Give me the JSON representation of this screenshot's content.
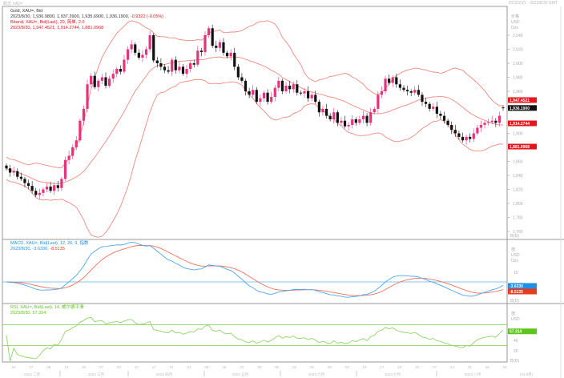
{
  "window": {
    "title": "概念 XAU=",
    "date_range": "2023/2/21 - 2023/8/30 GMT"
  },
  "legend": {
    "price_title": "Gold, XAU=, Bid",
    "price_values": "2023/8/30, 1,936.9800, 1,937.3900, 1,935.6900, 1,936.1900,",
    "price_change": "-0.9322 (-0.05%)",
    "bband_title": "Bband, XAU=, Bid(Last), 20, 简单, 2.0",
    "bband_values": "2023/8/30, 1,947.4521, 1,914.2744, 1,881.0968",
    "macd_title": "MACD, XAU=, Bid(Last), 12, 26, 9, 指数",
    "macd_values": "2023/8/30, -3.6330,",
    "macd_signal_value": "-8.5135",
    "rsi_title": "RSI, XAU=, Bid(Last), 14, 威尔德平滑",
    "rsi_values": "2023/8/30, 57.314"
  },
  "axis": {
    "price_header": [
      "价格",
      "USD",
      "Ozs"
    ],
    "price_ticks": [
      {
        "v": 2040,
        "t": "2,040"
      },
      {
        "v": 2020,
        "t": "2,020"
      },
      {
        "v": 2000,
        "t": "2,000"
      },
      {
        "v": 1980,
        "t": "1,980"
      },
      {
        "v": 1960,
        "t": "1,960"
      },
      {
        "v": 1900,
        "t": "1,900"
      },
      {
        "v": 1860,
        "t": "1,860"
      },
      {
        "v": 1840,
        "t": "1,840"
      },
      {
        "v": 1820,
        "t": "1,820"
      },
      {
        "v": 1800,
        "t": "1,800"
      },
      {
        "v": 1780,
        "t": "1,780"
      },
      {
        "v": 1760,
        "t": "1,760"
      }
    ],
    "macd_header": [
      "值",
      "USD",
      "Ozs"
    ],
    "macd_ticks": [
      {
        "v": 10,
        "t": "10"
      }
    ],
    "rsi_header": [
      "值",
      "USD"
    ],
    "rsi_ticks": [
      {
        "v": 40,
        "t": "40"
      },
      {
        "v": 20,
        "t": "20"
      }
    ],
    "pane_unit": "日(D)",
    "day_ticks": [
      "20",
      "27",
      "06",
      "13",
      "20",
      "27",
      "03",
      "10",
      "17",
      "24",
      "01",
      "08",
      "15",
      "22",
      "29",
      "05",
      "12",
      "19",
      "26",
      "03",
      "10",
      "17",
      "24",
      "31",
      "07",
      "14",
      "21",
      "28",
      "04"
    ],
    "month_labels": [
      "2023 二月",
      "2023 三月",
      "2023 四月",
      "2023 五月",
      "2023 六月",
      "2023 七月",
      "2023 八月",
      "(23 9月)"
    ]
  },
  "badges": {
    "bb_upper": {
      "text": "1,947.4521",
      "value": 1947.4521,
      "color": "#e8141c"
    },
    "last": {
      "text": "1,936.1900",
      "value": 1936.19,
      "color": "#111111"
    },
    "bb_mid": {
      "text": "1,914.2744",
      "value": 1914.2744,
      "color": "#e8141c"
    },
    "bb_lower": {
      "text": "1,881.0968",
      "value": 1881.0968,
      "color": "#e8141c"
    },
    "macd": {
      "text": "-3.6330",
      "value": -3.633,
      "color": "#1e90e8"
    },
    "signal": {
      "text": "-8.5135",
      "value": -8.5135,
      "color": "#e83a1c"
    },
    "rsi": {
      "text": "57.314",
      "value": 57.314,
      "color": "#5ec41a"
    }
  },
  "colors": {
    "up": "#e8327c",
    "down": "#111111",
    "bband": "#f08a80",
    "macd": "#4aa8ec",
    "signal": "#f0705a",
    "rsi": "#8fd46a",
    "rsi_levels": "#7ccc4a",
    "zero": "#5ab0f0"
  },
  "chart_data": {
    "type": "candlestick",
    "x_range": [
      "2023-02-21",
      "2023-08-30"
    ],
    "ylim": [
      1740,
      2060
    ],
    "bollinger": {
      "period": 20,
      "stddev": 2.0
    },
    "macd": {
      "fast": 12,
      "slow": 26,
      "signal": 9
    },
    "rsi": {
      "period": 14,
      "levels": [
        30,
        70
      ]
    },
    "last_bar": {
      "open": 1936.98,
      "high": 1937.39,
      "low": 1935.69,
      "close": 1936.19
    },
    "closes": [
      1850,
      1844,
      1846,
      1838,
      1835,
      1829,
      1825,
      1818,
      1812,
      1815,
      1820,
      1824,
      1818,
      1826,
      1822,
      1835,
      1862,
      1868,
      1880,
      1890,
      1918,
      1935,
      1970,
      1982,
      1966,
      1975,
      1980,
      1968,
      1978,
      1985,
      1992,
      1988,
      2005,
      2020,
      2027,
      2015,
      2008,
      2012,
      2020,
      2040,
      2004,
      2000,
      1995,
      1990,
      1988,
      2005,
      1990,
      1995,
      1985,
      1992,
      2000,
      1998,
      2018,
      2016,
      2040,
      2050,
      2025,
      2022,
      2030,
      2015,
      2010,
      2015,
      1995,
      1980,
      1975,
      1960,
      1955,
      1962,
      1945,
      1950,
      1958,
      1945,
      1952,
      1965,
      1975,
      1960,
      1968,
      1963,
      1970,
      1958,
      1957,
      1960,
      1950,
      1955,
      1945,
      1930,
      1935,
      1925,
      1920,
      1930,
      1915,
      1918,
      1910,
      1912,
      1920,
      1915,
      1920,
      1925,
      1915,
      1930,
      1935,
      1955,
      1960,
      1978,
      1972,
      1980,
      1970,
      1965,
      1962,
      1960,
      1958,
      1962,
      1955,
      1945,
      1942,
      1935,
      1938,
      1928,
      1925,
      1918,
      1912,
      1905,
      1900,
      1895,
      1890,
      1895,
      1892,
      1900,
      1908,
      1912,
      1915,
      1916,
      1918,
      1915,
      1925,
      1936.19
    ]
  }
}
